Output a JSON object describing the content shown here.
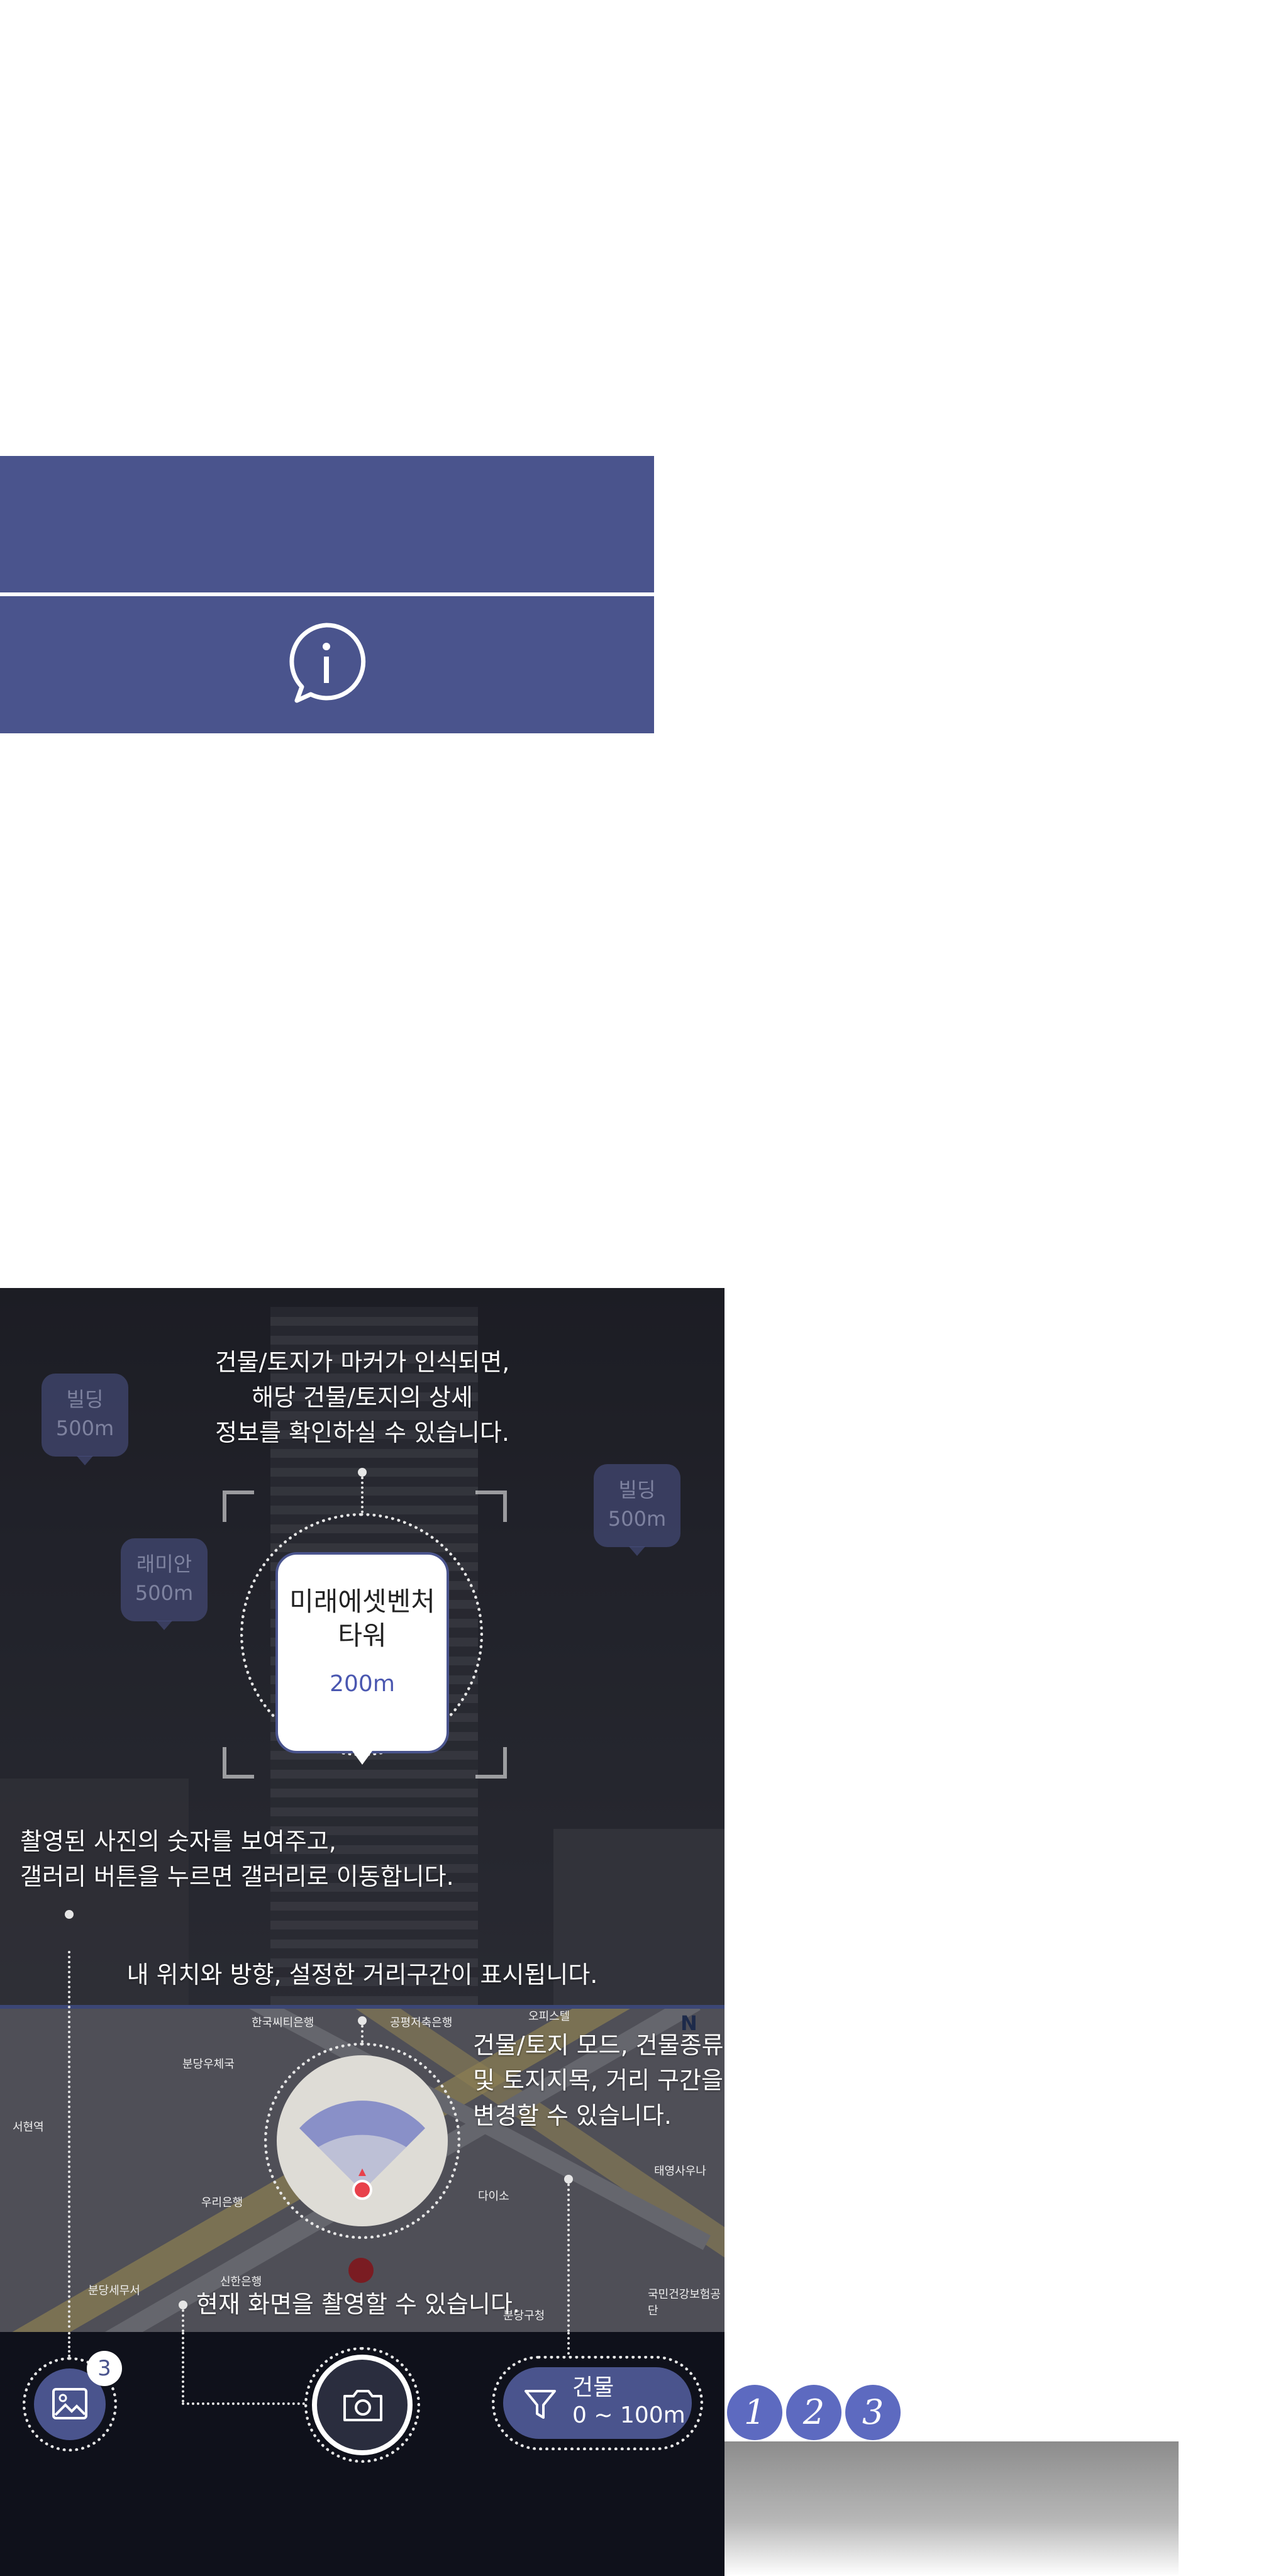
{
  "colors": {
    "panel": "#4a548d",
    "accent": "#5d6ac0",
    "bottom_bar": "#0f111b",
    "location_dot": "#e8414b"
  },
  "icons": {
    "info": "info-chat-bubble",
    "gallery": "image-icon",
    "camera": "camera-icon",
    "filter": "funnel-icon",
    "compass_north": "N"
  },
  "annotations": {
    "marker_info": [
      "건물/토지가 마커가 인식되면,",
      "해당 건물/토지의 상세",
      "정보를 확인하실 수 있습니다."
    ],
    "gallery_info": [
      "촬영된 사진의 숫자를 보여주고,",
      "갤러리 버튼을 누르면 갤러리로 이동합니다."
    ],
    "location_info": "내 위치와 방향, 설정한 거리구간이 표시됩니다.",
    "filter_info": [
      "건물/토지 모드, 건물종류",
      "및 토지지목, 거리 구간을",
      "변경할 수 있습니다."
    ],
    "capture_info": "현재 화면을 촬영할 수 있습니다."
  },
  "markers": [
    {
      "name": "빌딩",
      "distance": "500m"
    },
    {
      "name": "래미안",
      "distance": "500m"
    },
    {
      "name": "빌딩",
      "distance": "500m"
    }
  ],
  "selected_marker": {
    "name_line1": "미래에셋벤처",
    "name_line2": "타워",
    "distance": "200m"
  },
  "map": {
    "north_label": "N",
    "labels": [
      "한국씨티은행",
      "공평저축은행",
      "오피스텔",
      "분당우체국",
      "우리은행",
      "신한은행",
      "분당세무서",
      "국민건강보험공단",
      "태영사우나",
      "다이소",
      "서현역",
      "분당구청"
    ]
  },
  "bottom_bar": {
    "gallery_count": "3",
    "filter_mode": "건물",
    "filter_range": "0 ~ 100m"
  },
  "steps": [
    "1",
    "2",
    "3"
  ]
}
